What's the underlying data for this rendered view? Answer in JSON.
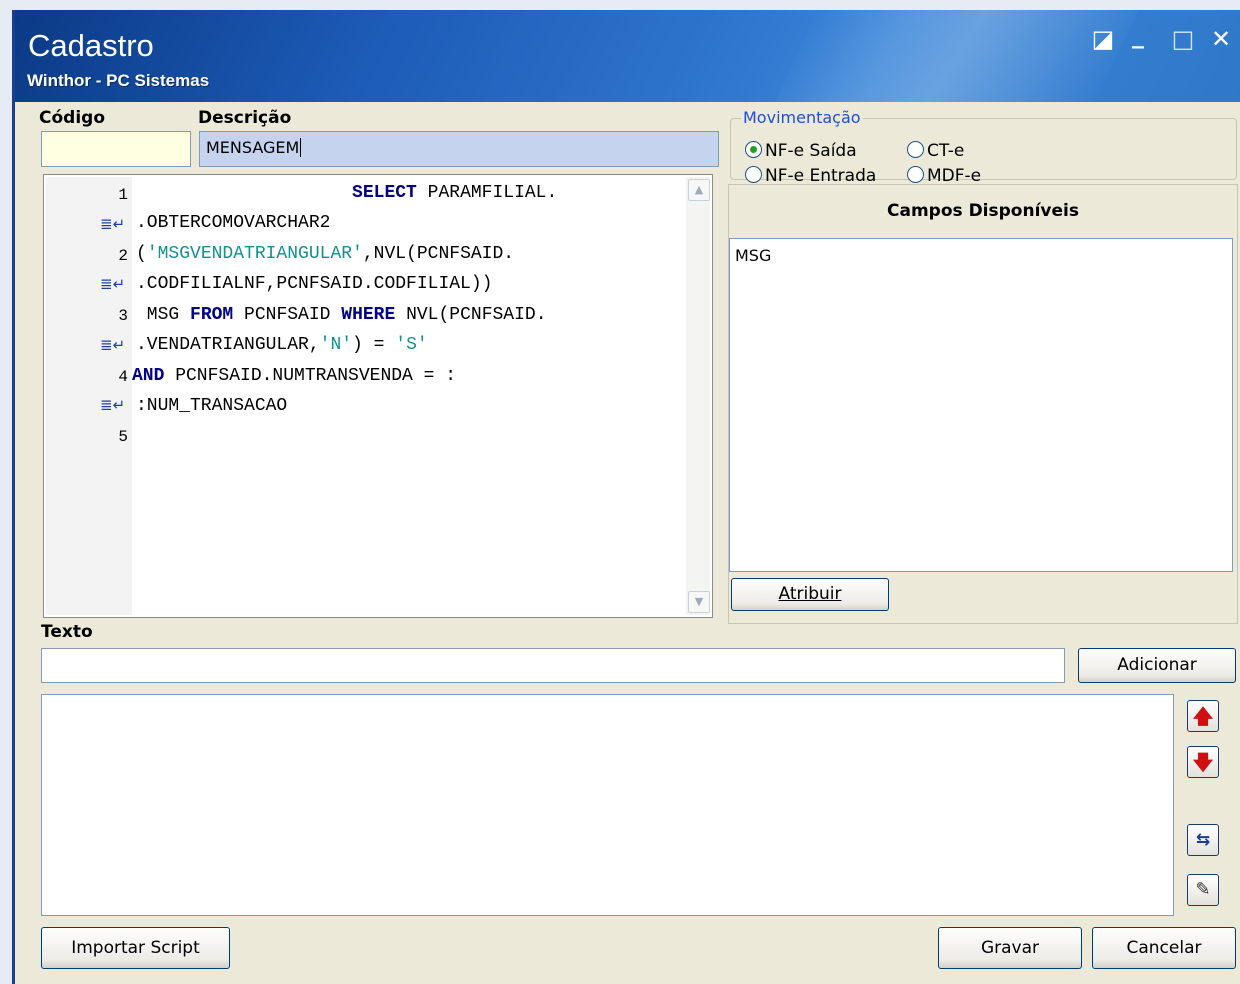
{
  "window": {
    "title": "Cadastro",
    "subtitle": "Winthor - PC Sistemas",
    "controls": {
      "restore": "◪",
      "minimize": "_",
      "maximize": "□",
      "close": "✕"
    }
  },
  "form": {
    "codigo_label": "Código",
    "codigo_value": "",
    "descricao_label": "Descrição",
    "descricao_value": "MENSAGEM"
  },
  "editor": {
    "line_numbers": [
      "1",
      "2",
      "3",
      "4",
      "5"
    ],
    "lines": [
      {
        "number": "1",
        "text": "                    SELECT PARAMFILIAL."
      },
      {
        "number": "",
        "text": ".OBTERCOMOVARCHAR2"
      },
      {
        "number": "2",
        "text": "('MSGVENDATRIANGULAR',NVL(PCNFSAID."
      },
      {
        "number": "",
        "text": ".CODFILIALNF,PCNFSAID.CODFILIAL))"
      },
      {
        "number": "3",
        "text": " MSG FROM PCNFSAID WHERE NVL(PCNFSAID."
      },
      {
        "number": "",
        "text": ".VENDATRIANGULAR,'N') = 'S'"
      },
      {
        "number": "4",
        "text": "AND PCNFSAID.NUMTRANSVENDA = :"
      },
      {
        "number": "",
        "text": ":NUM_TRANSACAO"
      },
      {
        "number": "5",
        "text": ""
      }
    ]
  },
  "movimentacao": {
    "title": "Movimentação",
    "options": [
      {
        "label": "NF-e Saída",
        "selected": true
      },
      {
        "label": "CT-e",
        "selected": false
      },
      {
        "label": "NF-e Entrada",
        "selected": false
      },
      {
        "label": "MDF-e",
        "selected": false
      }
    ]
  },
  "campos": {
    "title": "Campos Disponíveis",
    "items": [
      "MSG"
    ],
    "atribuir_label": "Atribuir"
  },
  "texto": {
    "label": "Texto",
    "value": "",
    "adicionar_label": "Adicionar"
  },
  "footer": {
    "importar_label": "Importar Script",
    "gravar_label": "Gravar",
    "cancelar_label": "Cancelar"
  },
  "colors": {
    "title_bar": "#2d73cc",
    "window_bg": "#ece9d8",
    "codigo_bg": "#ffffe1",
    "descricao_bg": "#c5d3ef",
    "sql_keyword": "#00008b",
    "sql_string": "#139090",
    "group_title": "#1e4fd8"
  }
}
